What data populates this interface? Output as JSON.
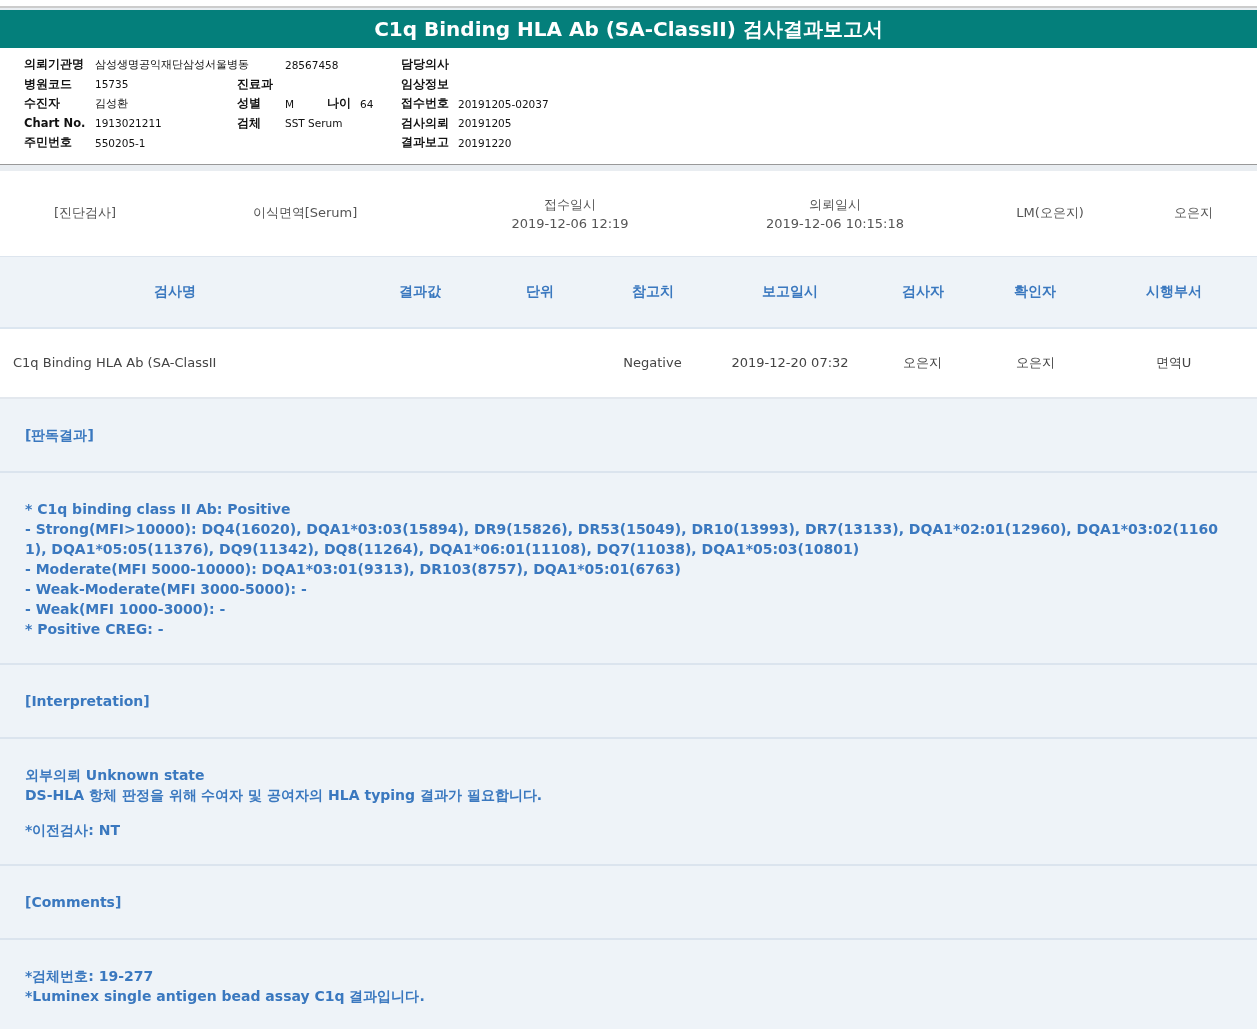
{
  "title": "C1q Binding HLA Ab (SA-ClassII) 검사결과보고서",
  "info_rows": [
    {
      "left": {
        "label": "의뢰기관명",
        "value": "삼성생명공익재단삼성서울병동"
      },
      "middle": {
        "value": "28567458"
      },
      "right": {
        "label": "담당의사"
      }
    },
    {
      "left": {
        "label": "병원코드",
        "value": "15735"
      },
      "middle": {
        "label": "진료과"
      },
      "right": {
        "label": "임상정보"
      }
    },
    {
      "left": {
        "label": "수진자",
        "value": "김성환"
      },
      "middle": {
        "label": "성별",
        "value": "M"
      },
      "age": {
        "label": "나이",
        "value": "64"
      },
      "right": {
        "label": "접수번호",
        "value": "20191205-02037"
      }
    },
    {
      "left": {
        "label": "Chart No.",
        "value": "1913021211"
      },
      "middle": {
        "label": "검체",
        "value": "SST Serum"
      },
      "right": {
        "label": "검사의뢰",
        "value": "20191205"
      }
    },
    {
      "left": {
        "label": "주민번호",
        "value": "550205-1"
      },
      "right": {
        "label": "결과보고",
        "value": "20191220"
      }
    }
  ],
  "order": [
    {
      "value": "[진단검사]"
    },
    {
      "value": "이식면역[Serum]"
    },
    {
      "label": "접수일시",
      "value": "2019-12-06 12:19"
    },
    {
      "label": "의뢰일시",
      "value": "2019-12-06 10:15:18"
    },
    {
      "value": "LM(오은지)"
    },
    {
      "value": "오은지"
    }
  ],
  "table": {
    "columns": [
      "검사명",
      "결과값",
      "단위",
      "참고치",
      "보고일시",
      "검사자",
      "확인자",
      "시행부서"
    ],
    "rows": [
      [
        "C1q Binding HLA Ab (SA-ClassII",
        null,
        null,
        "Negative",
        "2019-12-20 07:32",
        "오은지",
        "오은지",
        "면역U"
      ]
    ]
  },
  "sections": [
    {
      "kind": "heading",
      "text": "[판독결과]"
    },
    {
      "kind": "body",
      "paragraphs": [
        [
          "* C1q binding class II Ab: Positive",
          "- Strong(MFI>10000): DQ4(16020), DQA1*03:03(15894), DR9(15826), DR53(15049), DR10(13993), DR7(13133), DQA1*02:01(12960), DQA1*03:02(11601), DQA1*05:05(11376), DQ9(11342), DQ8(11264), DQA1*06:01(11108), DQ7(11038), DQA1*05:03(10801)",
          "- Moderate(MFI 5000-10000): DQA1*03:01(9313), DR103(8757), DQA1*05:01(6763)",
          "- Weak-Moderate(MFI 3000-5000): -",
          "- Weak(MFI 1000-3000): -",
          "* Positive CREG: -"
        ]
      ]
    },
    {
      "kind": "heading",
      "text": "[Interpretation]"
    },
    {
      "kind": "body",
      "paragraphs": [
        [
          "외부의뢰 Unknown state",
          "DS-HLA 항체 판정을 위해 수여자 및 공여자의 HLA typing 결과가 필요합니다."
        ],
        [
          "*이전검사: NT"
        ]
      ]
    },
    {
      "kind": "heading",
      "text": "[Comments]"
    },
    {
      "kind": "body",
      "paragraphs": [
        [
          "*검체번호: 19-277",
          "*Luminex single antigen bead assay C1q 결과입니다."
        ]
      ]
    }
  ]
}
